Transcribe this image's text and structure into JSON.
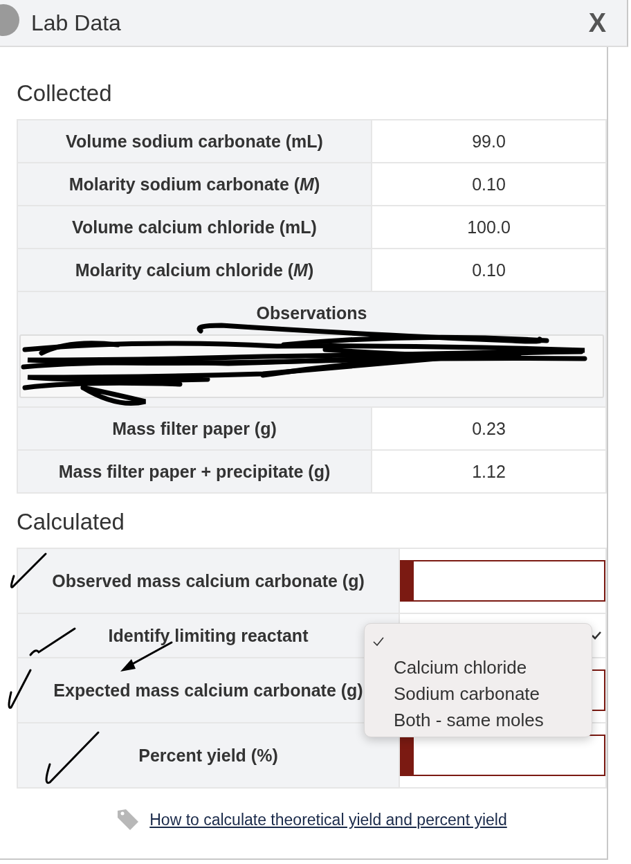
{
  "window": {
    "title": "Lab Data",
    "close": "X"
  },
  "collected": {
    "heading": "Collected",
    "rows": [
      {
        "label": "Volume sodium carbonate (mL)",
        "value": "99.0"
      },
      {
        "label": "Molarity sodium carbonate (*M*)",
        "value": "0.10"
      },
      {
        "label": "Volume calcium chloride (mL)",
        "value": "100.0"
      },
      {
        "label": "Molarity calcium chloride (*M*)",
        "value": "0.10"
      }
    ],
    "observations": {
      "label": "Observations"
    },
    "rows_after": [
      {
        "label": "Mass filter paper (g)",
        "value": "0.23"
      },
      {
        "label": "Mass filter paper + precipitate (g)",
        "value": "1.12"
      }
    ]
  },
  "calculated": {
    "heading": "Calculated",
    "rows": [
      {
        "label": "Observed mass calcium carbonate (g)",
        "kind": "input"
      },
      {
        "label": "Identify limiting reactant",
        "kind": "select"
      },
      {
        "label": "Expected mass calcium carbonate (g)",
        "kind": "input"
      },
      {
        "label": "Percent yield (%)",
        "kind": "input"
      }
    ]
  },
  "dropdown": {
    "blank_option": {
      "selected": true
    },
    "options": [
      {
        "label": "Calcium chloride",
        "selected": false
      },
      {
        "label": "Sodium carbonate",
        "selected": false
      },
      {
        "label": "Both - same moles",
        "selected": false
      }
    ]
  },
  "link": {
    "text": "How to calculate theoretical yield and percent yield"
  }
}
